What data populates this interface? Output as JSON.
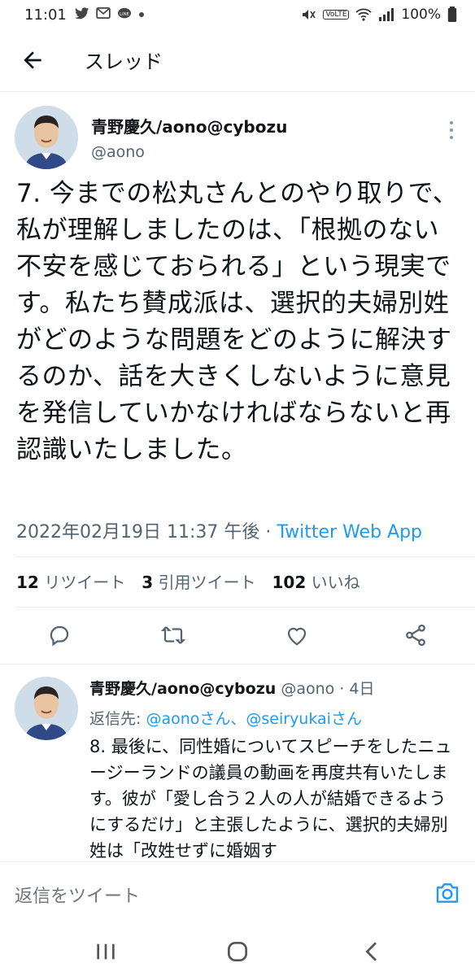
{
  "status_bar": {
    "time": "11:01",
    "network": "VoLTE",
    "battery": "100%",
    "left_icons": [
      "twitter-icon",
      "gmail-icon",
      "line-icon",
      "dot-icon"
    ]
  },
  "header": {
    "title": "スレッド"
  },
  "main_tweet": {
    "name": "青野慶久/aono@cybozu",
    "handle": "@aono",
    "text": "7. 今までの松丸さんとのやり取りで、私が理解しましたのは、「根拠のない不安を感じておられる」という現実です。私たち賛成派は、選択的夫婦別姓がどのような問題をどのように解決するのか、話を大きくしないように意見を発信していかなければならないと再認識いたしました。",
    "timestamp": "2022年02月19日 11:37 午後",
    "separator": " · ",
    "via": "Twitter Web App",
    "retweets_count": "12",
    "retweets_label": "リツイート",
    "quotes_count": "3",
    "quotes_label": "引用ツイート",
    "likes_count": "102",
    "likes_label": "いいね"
  },
  "reply_tweet": {
    "name": "青野慶久/aono@cybozu",
    "handle": "@aono",
    "separator": " · ",
    "age": "4日",
    "reply_to_prefix": "返信先: ",
    "reply_to_links": "@aonoさん、@seiryukaiさん",
    "text": "8. 最後に、同性婚についてスピーチをしたニュージーランドの議員の動画を再度共有いたします。彼が「愛し合う２人の人が結婚できるようにするだけ」と主張したように、選択的夫婦別姓は「改姓せずに婚姻す"
  },
  "compose": {
    "placeholder": "返信をツイート"
  },
  "colors": {
    "accent": "#1d9bf0",
    "text": "#0f1419",
    "secondary": "#536471"
  }
}
